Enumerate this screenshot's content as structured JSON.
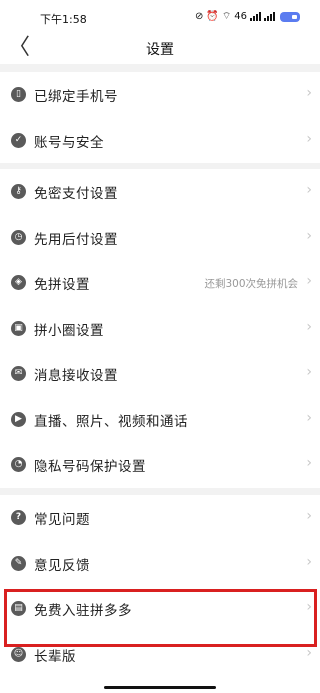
{
  "status": {
    "time": "下午1:58",
    "signal_text": "46"
  },
  "header": {
    "back_symbol": "〈",
    "title": "设置"
  },
  "groups": [
    {
      "items": [
        {
          "label": "已绑定手机号",
          "icon": "phone-icon"
        },
        {
          "label": "账号与安全",
          "icon": "shield-icon"
        }
      ]
    },
    {
      "items": [
        {
          "label": "免密支付设置",
          "icon": "key-icon"
        },
        {
          "label": "先用后付设置",
          "icon": "clock-icon"
        },
        {
          "label": "免拼设置",
          "icon": "group-icon",
          "note": "还剩300次免拼机会"
        },
        {
          "label": "拼小圈设置",
          "icon": "lock-icon"
        },
        {
          "label": "消息接收设置",
          "icon": "message-icon"
        },
        {
          "label": "直播、照片、视频和通话",
          "icon": "video-icon"
        },
        {
          "label": "隐私号码保护设置",
          "icon": "privacy-icon"
        }
      ]
    },
    {
      "items": [
        {
          "label": "常见问题",
          "icon": "question-icon"
        },
        {
          "label": "意见反馈",
          "icon": "feedback-icon"
        },
        {
          "label": "免费入驻拼多多",
          "icon": "store-icon"
        },
        {
          "label": "长辈版",
          "icon": "elder-icon"
        }
      ]
    }
  ],
  "chevron": "›",
  "colors": {
    "highlight_border": "#d92020",
    "icon_bg": "#5a5a5a",
    "page_bg": "#f2f2f2"
  }
}
